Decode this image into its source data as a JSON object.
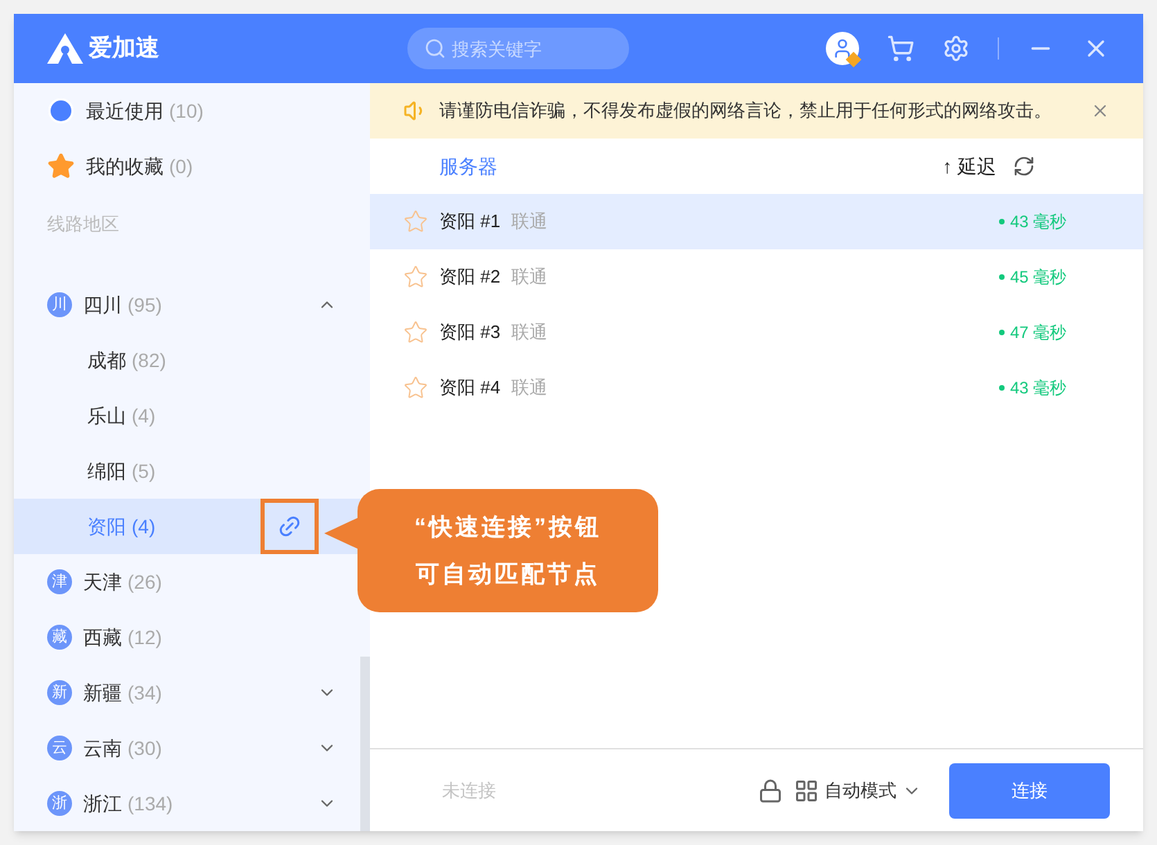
{
  "app": {
    "name": "爱加速"
  },
  "search": {
    "placeholder": "搜索关键字"
  },
  "sidebar": {
    "shortcuts": [
      {
        "kind": "recent",
        "label": "最近使用",
        "count": "(10)"
      },
      {
        "kind": "favorite",
        "label": "我的收藏",
        "count": "(0)"
      }
    ],
    "section_title": "线路地区",
    "regions": [
      {
        "badge": "川",
        "label": "四川",
        "count": "(95)",
        "expanded": true,
        "children": [
          {
            "label": "成都",
            "count": "(82)",
            "selected": false,
            "quick_connect": false
          },
          {
            "label": "乐山",
            "count": "(4)",
            "selected": false,
            "quick_connect": false
          },
          {
            "label": "绵阳",
            "count": "(5)",
            "selected": false,
            "quick_connect": false
          },
          {
            "label": "资阳",
            "count": "(4)",
            "selected": true,
            "quick_connect": true
          }
        ]
      },
      {
        "badge": "津",
        "label": "天津",
        "count": "(26)"
      },
      {
        "badge": "藏",
        "label": "西藏",
        "count": "(12)"
      },
      {
        "badge": "新",
        "label": "新疆",
        "count": "(34)",
        "expanded": false
      },
      {
        "badge": "云",
        "label": "云南",
        "count": "(30)",
        "expanded": false
      },
      {
        "badge": "浙",
        "label": "浙江",
        "count": "(134)",
        "expanded": false
      }
    ]
  },
  "notice": {
    "text": "请谨防电信诈骗，不得发布虚假的网络言论，禁止用于任何形式的网络攻击。"
  },
  "table": {
    "columns": [
      "服务器",
      "↑ 延迟"
    ],
    "rows": [
      {
        "name": "资阳 #1",
        "isp": "联通",
        "latency": "43 毫秒",
        "selected": true
      },
      {
        "name": "资阳 #2",
        "isp": "联通",
        "latency": "45 毫秒",
        "selected": false
      },
      {
        "name": "资阳 #3",
        "isp": "联通",
        "latency": "47 毫秒",
        "selected": false
      },
      {
        "name": "资阳 #4",
        "isp": "联通",
        "latency": "43 毫秒",
        "selected": false
      }
    ]
  },
  "callout": {
    "lines": [
      "“快速连接”按钮",
      "可自动匹配节点"
    ]
  },
  "footer": {
    "status": "未连接",
    "mode": "自动模式",
    "connect_button": "连接"
  }
}
